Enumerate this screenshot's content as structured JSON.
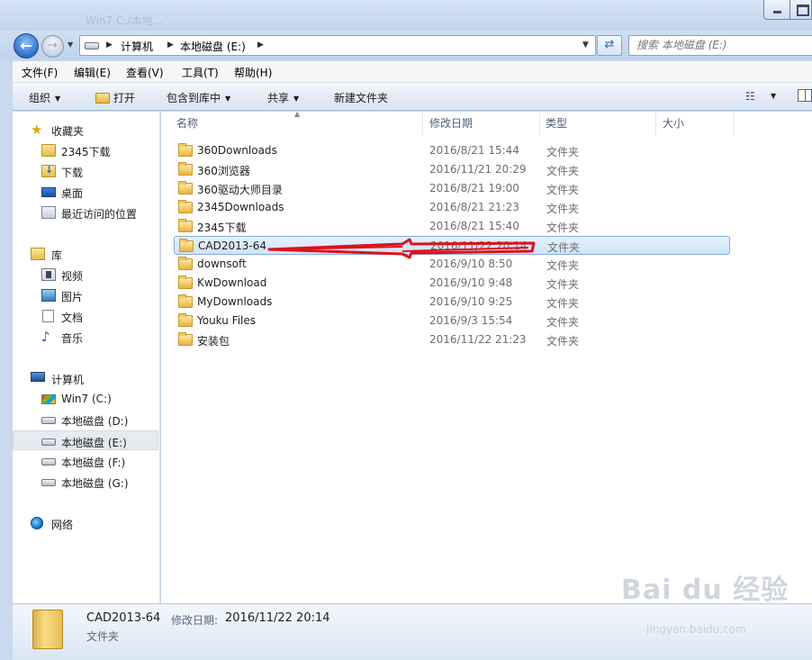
{
  "window": {
    "ghost_title": "Win7 C:/本地..."
  },
  "address": {
    "crumbs": [
      "计算机",
      "本地磁盘 (E:)"
    ],
    "search_placeholder": "搜索 本地磁盘 (E:)"
  },
  "menu": [
    "文件(F)",
    "编辑(E)",
    "查看(V)",
    "工具(T)",
    "帮助(H)"
  ],
  "toolbar": {
    "organize": "组织",
    "open": "打开",
    "include_in_library": "包含到库中",
    "share": "共享",
    "new_folder": "新建文件夹"
  },
  "nav": {
    "favorites": {
      "label": "收藏夹",
      "items": [
        "2345下载",
        "下载",
        "桌面",
        "最近访问的位置"
      ]
    },
    "libraries": {
      "label": "库",
      "items": [
        "视频",
        "图片",
        "文档",
        "音乐"
      ]
    },
    "computer": {
      "label": "计算机",
      "items": [
        "Win7 (C:)",
        "本地磁盘 (D:)",
        "本地磁盘 (E:)",
        "本地磁盘 (F:)",
        "本地磁盘 (G:)"
      ]
    },
    "network": {
      "label": "网络"
    }
  },
  "columns": {
    "name": "名称",
    "date": "修改日期",
    "type": "类型",
    "size": "大小"
  },
  "files": [
    {
      "name": "360Downloads",
      "date": "2016/8/21 15:44",
      "type": "文件夹"
    },
    {
      "name": "360浏览器",
      "date": "2016/11/21 20:29",
      "type": "文件夹"
    },
    {
      "name": "360驱动大师目录",
      "date": "2016/8/21 19:00",
      "type": "文件夹"
    },
    {
      "name": "2345Downloads",
      "date": "2016/8/21 21:23",
      "type": "文件夹"
    },
    {
      "name": "2345下载",
      "date": "2016/8/21 15:40",
      "type": "文件夹"
    },
    {
      "name": "CAD2013-64",
      "date": "2016/11/22 20:14",
      "type": "文件夹"
    },
    {
      "name": "downsoft",
      "date": "2016/9/10 8:50",
      "type": "文件夹"
    },
    {
      "name": "KwDownload",
      "date": "2016/9/10 9:48",
      "type": "文件夹"
    },
    {
      "name": "MyDownloads",
      "date": "2016/9/10 9:25",
      "type": "文件夹"
    },
    {
      "name": "Youku Files",
      "date": "2016/9/3 15:54",
      "type": "文件夹"
    },
    {
      "name": "安装包",
      "date": "2016/11/22 21:23",
      "type": "文件夹"
    }
  ],
  "details": {
    "name": "CAD2013-64",
    "date_label": "修改日期:",
    "date": "2016/11/22 20:14",
    "type": "文件夹"
  },
  "watermark": {
    "main": "Bai du 经验",
    "sub": "jingyan.baidu.com"
  },
  "colors": {
    "selection": "#cfe4fa",
    "selection_border": "#84acdd",
    "annotation": "#e0101a"
  }
}
